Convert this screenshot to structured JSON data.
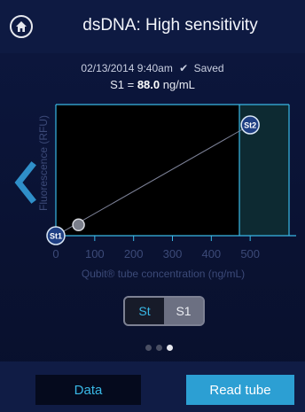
{
  "header": {
    "title": "dsDNA: High sensitivity",
    "home_icon": "home-icon"
  },
  "status": {
    "timestamp": "02/13/2014 9:40am",
    "saved_label": "Saved",
    "result_label": "S1 =",
    "result_value": "88.0",
    "result_unit": "ng/mL"
  },
  "chart_data": {
    "type": "line",
    "xlabel": "Qubit® tube concentration (ng/mL)",
    "ylabel": "Fluorescence (RFU)",
    "xlim": [
      0,
      600
    ],
    "x_ticks": [
      "0",
      "100",
      "200",
      "300",
      "400",
      "500"
    ],
    "grid": false,
    "standards": [
      {
        "label": "St1",
        "x": 0,
        "y": 0
      },
      {
        "label": "St2",
        "x": 500,
        "y": 1
      }
    ],
    "sample": {
      "label": "S1",
      "x": 88,
      "y": 0.17
    }
  },
  "toggle": {
    "options": [
      "St",
      "S1"
    ],
    "selected": "St"
  },
  "pager": {
    "count": 3,
    "active_index": 2
  },
  "footer": {
    "data_label": "Data",
    "read_label": "Read tube"
  },
  "colors": {
    "accent": "#39b8e6",
    "button_primary": "#2c9fd3",
    "background": "#0b1236"
  }
}
